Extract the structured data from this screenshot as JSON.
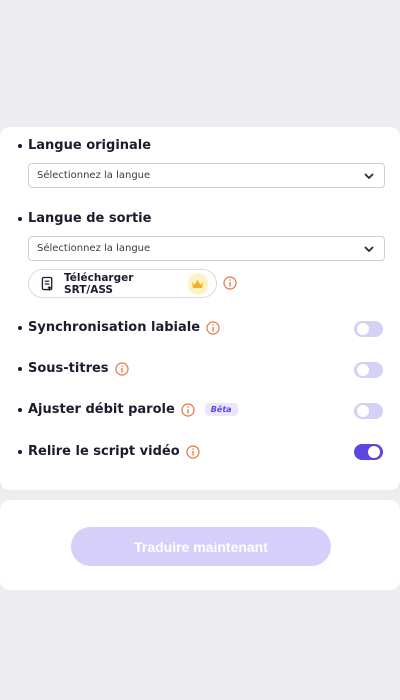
{
  "original_language": {
    "label": "Langue originale",
    "placeholder": "Sélectionnez la langue"
  },
  "output_language": {
    "label": "Langue de sortie",
    "placeholder": "Sélectionnez la langue"
  },
  "download": {
    "label": "Télécharger SRT/ASS",
    "icon": "document-upload-icon",
    "premium_icon": "crown-icon"
  },
  "options": [
    {
      "label": "Synchronisation labiale",
      "enabled": false
    },
    {
      "label": "Sous-titres",
      "enabled": false
    },
    {
      "label": "Ajuster débit parole",
      "badge": "Bêta",
      "enabled": false
    },
    {
      "label": "Relire le script vidéo",
      "enabled": true
    }
  ],
  "action": {
    "translate_label": "Traduire maintenant"
  },
  "colors": {
    "accent": "#5a48e0",
    "toggle_off": "#d4d1f6",
    "info": "#e8743b",
    "button_disabled": "#d5cffa"
  }
}
